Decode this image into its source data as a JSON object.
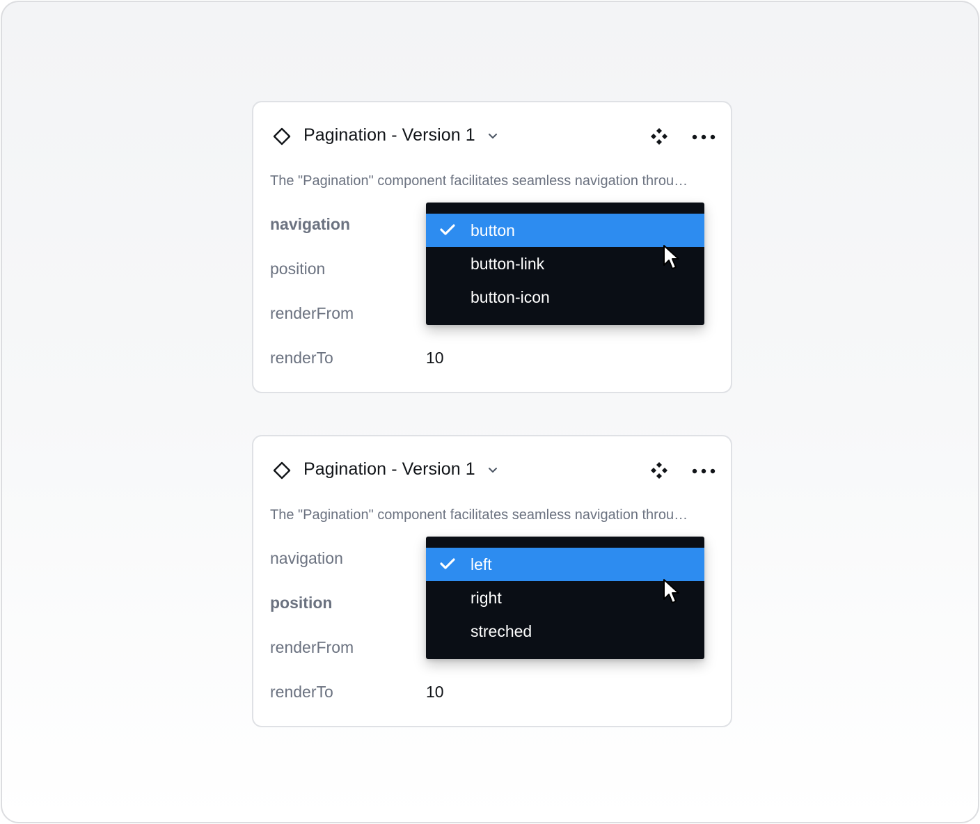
{
  "colors": {
    "accent": "#2d8cf0",
    "dropdown_bg": "#0a0e15",
    "muted_text": "#6b7280",
    "text": "#111418"
  },
  "cards": [
    {
      "title": "Pagination - Version 1",
      "description": "The \"Pagination\" component facilitates seamless navigation throu…",
      "props": [
        {
          "label": "navigation",
          "active": true
        },
        {
          "label": "position",
          "active": false
        },
        {
          "label": "renderFrom",
          "active": false
        },
        {
          "label": "renderTo",
          "active": false,
          "value": "10"
        }
      ],
      "dropdown": {
        "for": "navigation",
        "options": [
          "button",
          "button-link",
          "button-icon"
        ],
        "selected": "button"
      }
    },
    {
      "title": "Pagination - Version 1",
      "description": "The \"Pagination\" component facilitates seamless navigation throu…",
      "props": [
        {
          "label": "navigation",
          "active": false
        },
        {
          "label": "position",
          "active": true
        },
        {
          "label": "renderFrom",
          "active": false
        },
        {
          "label": "renderTo",
          "active": false,
          "value": "10"
        }
      ],
      "dropdown": {
        "for": "position",
        "options": [
          "left",
          "right",
          "streched"
        ],
        "selected": "left"
      }
    }
  ],
  "icons": {
    "component": "component-diamond-icon",
    "title_caret": "chevron-down-icon",
    "variants": "variants-icon",
    "more": "more-horizontal-icon",
    "check": "check-icon",
    "cursor": "mouse-pointer-icon"
  }
}
